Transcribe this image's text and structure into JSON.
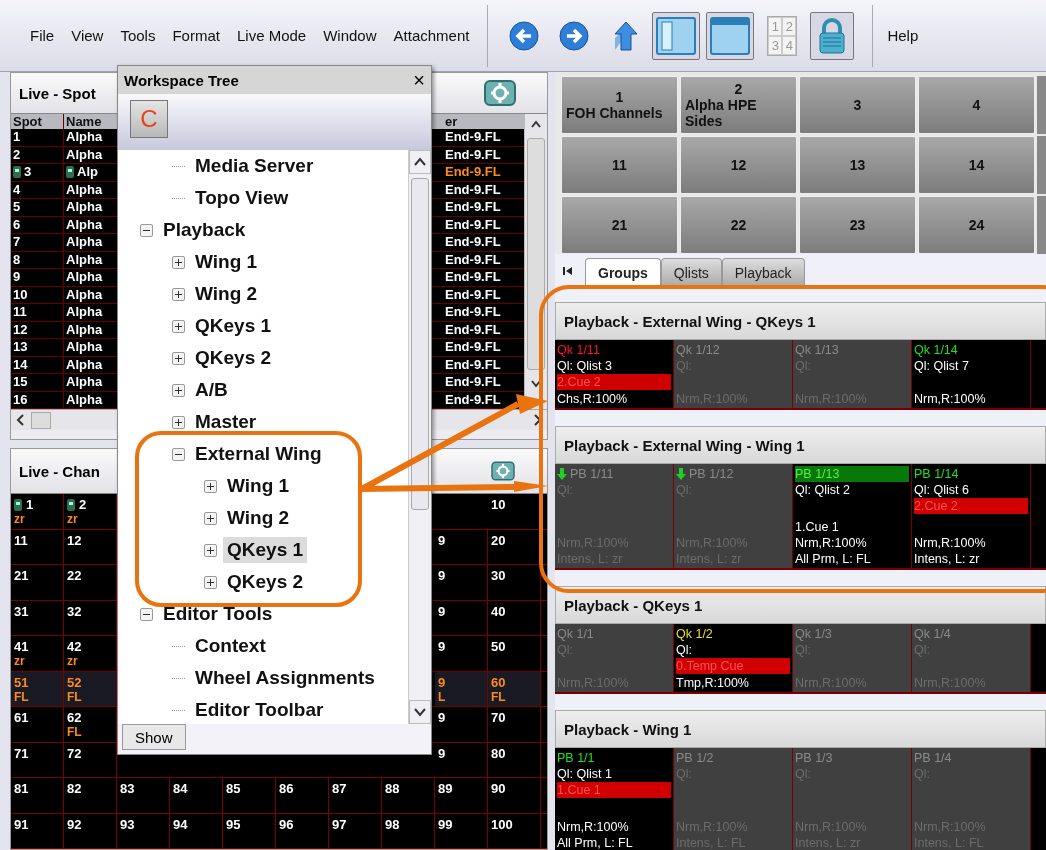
{
  "menu": {
    "items": [
      "File",
      "View",
      "Tools",
      "Format",
      "Live Mode",
      "Window",
      "Attachment"
    ],
    "tools": [
      {
        "kind": "back",
        "selected": false
      },
      {
        "kind": "forward",
        "selected": false
      },
      {
        "kind": "up",
        "selected": false
      },
      {
        "kind": "sidebar",
        "selected": true
      },
      {
        "kind": "window",
        "selected": true
      },
      {
        "kind": "digits",
        "selected": false,
        "digits": [
          "1",
          "2",
          "3",
          "4"
        ]
      },
      {
        "kind": "lock",
        "selected": true
      }
    ],
    "help": "Help"
  },
  "spot_window": {
    "title": "Live - Spot",
    "columns": [
      "Spot",
      "Name",
      "er"
    ],
    "rows": [
      {
        "spot": "1",
        "name": "Alpha",
        "column_3": "End-9.FL",
        "active": false
      },
      {
        "spot": "2",
        "name": "Alpha",
        "column_3": "End-9.FL",
        "active": false
      },
      {
        "spot": "3",
        "name": "Alp",
        "column_3": "End-9.FL",
        "active": true
      },
      {
        "spot": "4",
        "name": "Alpha",
        "column_3": "End-9.FL",
        "active": false
      },
      {
        "spot": "5",
        "name": "Alpha",
        "column_3": "End-9.FL",
        "active": false
      },
      {
        "spot": "6",
        "name": "Alpha",
        "column_3": "End-9.FL",
        "active": false
      },
      {
        "spot": "7",
        "name": "Alpha",
        "column_3": "End-9.FL",
        "active": false
      },
      {
        "spot": "8",
        "name": "Alpha",
        "column_3": "End-9.FL",
        "active": false
      },
      {
        "spot": "9",
        "name": "Alpha",
        "column_3": "End-9.FL",
        "active": false
      },
      {
        "spot": "10",
        "name": "Alpha",
        "column_3": "End-9.FL",
        "active": false
      },
      {
        "spot": "11",
        "name": "Alpha",
        "column_3": "End-9.FL",
        "active": false
      },
      {
        "spot": "12",
        "name": "Alpha",
        "column_3": "End-9.FL",
        "active": false
      },
      {
        "spot": "13",
        "name": "Alpha",
        "column_3": "End-9.FL",
        "active": false
      },
      {
        "spot": "14",
        "name": "Alpha",
        "column_3": "End-9.FL",
        "active": false
      },
      {
        "spot": "15",
        "name": "Alpha",
        "column_3": "End-9.FL",
        "active": false
      },
      {
        "spot": "16",
        "name": "Alpha",
        "column_3": "End-9.FL",
        "active": false
      }
    ]
  },
  "chan_window": {
    "title": "Live - Chan",
    "rows": [
      {
        "kind": "split",
        "left": [
          {
            "num": "1",
            "sub": "zr",
            "icon": true
          },
          {
            "num": "2",
            "sub": "zr",
            "icon": true
          }
        ],
        "right": [
          {
            "num": "10"
          }
        ]
      },
      {
        "kind": "split",
        "left": [
          {
            "num": "11"
          },
          {
            "num": "12"
          }
        ],
        "right": [
          {
            "num": "9"
          },
          {
            "num": "20"
          }
        ]
      },
      {
        "kind": "split",
        "left": [
          {
            "num": "21"
          },
          {
            "num": "22"
          }
        ],
        "right": [
          {
            "num": "9"
          },
          {
            "num": "30"
          }
        ]
      },
      {
        "kind": "split",
        "left": [
          {
            "num": "31"
          },
          {
            "num": "32"
          }
        ],
        "right": [
          {
            "num": "9"
          },
          {
            "num": "40"
          }
        ]
      },
      {
        "kind": "split",
        "left": [
          {
            "num": "41",
            "sub": "zr"
          },
          {
            "num": "42",
            "sub": "zr"
          }
        ],
        "right": [
          {
            "num": "9"
          },
          {
            "num": "50"
          }
        ]
      },
      {
        "kind": "split",
        "left": [
          {
            "num": "51",
            "sub": "FL",
            "active": true
          },
          {
            "num": "52",
            "sub": "FL",
            "active": true
          }
        ],
        "right": [
          {
            "num": "9",
            "sub": "L",
            "active": true
          },
          {
            "num": "60",
            "sub": "FL",
            "active": true
          }
        ]
      },
      {
        "kind": "split",
        "left": [
          {
            "num": "61"
          },
          {
            "num": "62",
            "sub": "FL"
          }
        ],
        "right": [
          {
            "num": "9"
          },
          {
            "num": "70"
          }
        ]
      },
      {
        "kind": "split",
        "left": [
          {
            "num": "71"
          },
          {
            "num": "72"
          }
        ],
        "right": [
          {
            "num": "9"
          },
          {
            "num": "80"
          }
        ]
      },
      {
        "kind": "full",
        "cells": [
          {
            "num": "81"
          },
          {
            "num": "82"
          },
          {
            "num": "83"
          },
          {
            "num": "84"
          },
          {
            "num": "85"
          },
          {
            "num": "86"
          },
          {
            "num": "87"
          },
          {
            "num": "88"
          },
          {
            "num": "89"
          },
          {
            "num": "90"
          }
        ]
      },
      {
        "kind": "full",
        "cells": [
          {
            "num": "91"
          },
          {
            "num": "92"
          },
          {
            "num": "93"
          },
          {
            "num": "94"
          },
          {
            "num": "95"
          },
          {
            "num": "96"
          },
          {
            "num": "97"
          },
          {
            "num": "98"
          },
          {
            "num": "99"
          },
          {
            "num": "100"
          }
        ]
      }
    ]
  },
  "workspace_tree": {
    "title": "Workspace Tree",
    "close": "×",
    "c_button": "C",
    "scrolled_children": [
      {
        "label": "Media Server",
        "selected": false
      },
      {
        "label": "Topo View",
        "selected": false
      }
    ],
    "items": [
      {
        "label": "Playback",
        "expanded": true,
        "selected": false,
        "children": [
          {
            "label": "Wing 1",
            "expanded": false,
            "selected": false
          },
          {
            "label": "Wing 2",
            "expanded": false,
            "selected": false
          },
          {
            "label": "QKeys 1",
            "expanded": false,
            "selected": false
          },
          {
            "label": "QKeys 2",
            "expanded": false,
            "selected": false
          },
          {
            "label": "A/B",
            "expanded": false,
            "selected": false
          },
          {
            "label": "Master",
            "expanded": false,
            "selected": false
          },
          {
            "label": "External Wing",
            "expanded": true,
            "selected": false,
            "children": [
              {
                "label": "Wing 1",
                "expanded": false,
                "selected": false
              },
              {
                "label": "Wing 2",
                "expanded": false,
                "selected": false
              },
              {
                "label": "QKeys 1",
                "expanded": false,
                "selected": true
              },
              {
                "label": "QKeys 2",
                "expanded": false,
                "selected": false
              }
            ]
          }
        ]
      },
      {
        "label": "Editor Tools",
        "expanded": true,
        "selected": false,
        "children": [
          {
            "label": "Context",
            "selected": false
          },
          {
            "label": "Wheel Assignments",
            "selected": false
          },
          {
            "label": "Editor Toolbar",
            "selected": false
          }
        ]
      }
    ],
    "show_button": "Show"
  },
  "groups": [
    [
      {
        "num": "1",
        "label": "FOH Channels"
      },
      {
        "num": "2",
        "label": "Alpha HPE Sides"
      },
      {
        "num": "3"
      },
      {
        "num": "4"
      }
    ],
    [
      {
        "num": "11"
      },
      {
        "num": "12"
      },
      {
        "num": "13"
      },
      {
        "num": "14"
      }
    ],
    [
      {
        "num": "21"
      },
      {
        "num": "22"
      },
      {
        "num": "23"
      },
      {
        "num": "24"
      }
    ]
  ],
  "tabs": [
    {
      "label": "Groups",
      "selected": true
    },
    {
      "label": "Qlists",
      "selected": false
    },
    {
      "label": "Playback",
      "selected": false
    }
  ],
  "sections": [
    {
      "title": "Playback - External Wing - QKeys 1",
      "kind": "qkeys",
      "cells": [
        {
          "id": "Qk 1/11",
          "active": true,
          "color": "#ff1040",
          "qlist": "Ql: Qlist 3",
          "cue": "2.Cue 2",
          "bottom": [
            "Chs,R:100%"
          ]
        },
        {
          "id": "Qk 1/12",
          "active": false,
          "qlist": "Ql:",
          "bottom": [
            "Nrm,R:100%"
          ]
        },
        {
          "id": "Qk 1/13",
          "active": false,
          "qlist": "Ql:",
          "bottom": [
            "Nrm,R:100%"
          ]
        },
        {
          "id": "Qk 1/14",
          "active": true,
          "color": "#20e020",
          "qlist": "Ql: Qlist 7",
          "bottom": [
            "Nrm,R:100%"
          ]
        }
      ]
    },
    {
      "title": "Playback - External Wing - Wing 1",
      "kind": "wing",
      "cells": [
        {
          "id": "PB 1/11",
          "active": false,
          "arrow": true,
          "qlist": "Ql:",
          "bottom": [
            "Nrm,R:100%",
            "Intens, L: zr"
          ]
        },
        {
          "id": "PB 1/12",
          "active": false,
          "arrow": true,
          "qlist": "Ql:",
          "bottom": [
            "Nrm,R:100%",
            "Intens, L: zr"
          ]
        },
        {
          "id": "PB 1/13",
          "active": true,
          "highlighted": true,
          "qlist": "Ql: Qlist 2",
          "bottom": [
            "1.Cue 1",
            "Nrm,R:100%",
            "All Prm, L: FL"
          ]
        },
        {
          "id": "PB 1/14",
          "active": true,
          "color": "#20e020",
          "qlist": "Ql: Qlist 6",
          "cue": "2.Cue 2",
          "bottom": [
            "Nrm,R:100%",
            "Intens, L: zr"
          ]
        }
      ]
    },
    {
      "title": "Playback - QKeys 1",
      "kind": "qkeys",
      "cells": [
        {
          "id": "Qk 1/1",
          "active": false,
          "qlist": "Ql:",
          "bottom": [
            "Nrm,R:100%"
          ]
        },
        {
          "id": "Qk 1/2",
          "active": true,
          "color": "#e8e020",
          "qlist": "Ql:",
          "cue": "0.Temp Cue",
          "bottom": [
            "Tmp,R:100%"
          ]
        },
        {
          "id": "Qk 1/3",
          "active": false,
          "qlist": "Ql:",
          "bottom": [
            "Nrm,R:100%"
          ]
        },
        {
          "id": "Qk 1/4",
          "active": false,
          "qlist": "Ql:",
          "bottom": [
            "Nrm,R:100%"
          ]
        }
      ]
    },
    {
      "title": "Playback - Wing 1",
      "kind": "wing",
      "cells": [
        {
          "id": "PB 1/1",
          "active": true,
          "color": "#20e020",
          "qlist": "Ql: Qlist 1",
          "cue": "1.Cue 1",
          "bottom": [
            "Nrm,R:100%",
            "All Prm, L: FL"
          ]
        },
        {
          "id": "PB 1/2",
          "active": false,
          "qlist": "Ql:",
          "bottom": [
            "Nrm,R:100%",
            "Intens, L: FL"
          ]
        },
        {
          "id": "PB 1/3",
          "active": false,
          "qlist": "Ql:",
          "bottom": [
            "Nrm,R:100%",
            "Intens, L: zr"
          ]
        },
        {
          "id": "PB 1/4",
          "active": false,
          "qlist": "Ql:",
          "bottom": [
            "Nrm,R:100%",
            "Intens, L: FL"
          ]
        }
      ]
    }
  ]
}
